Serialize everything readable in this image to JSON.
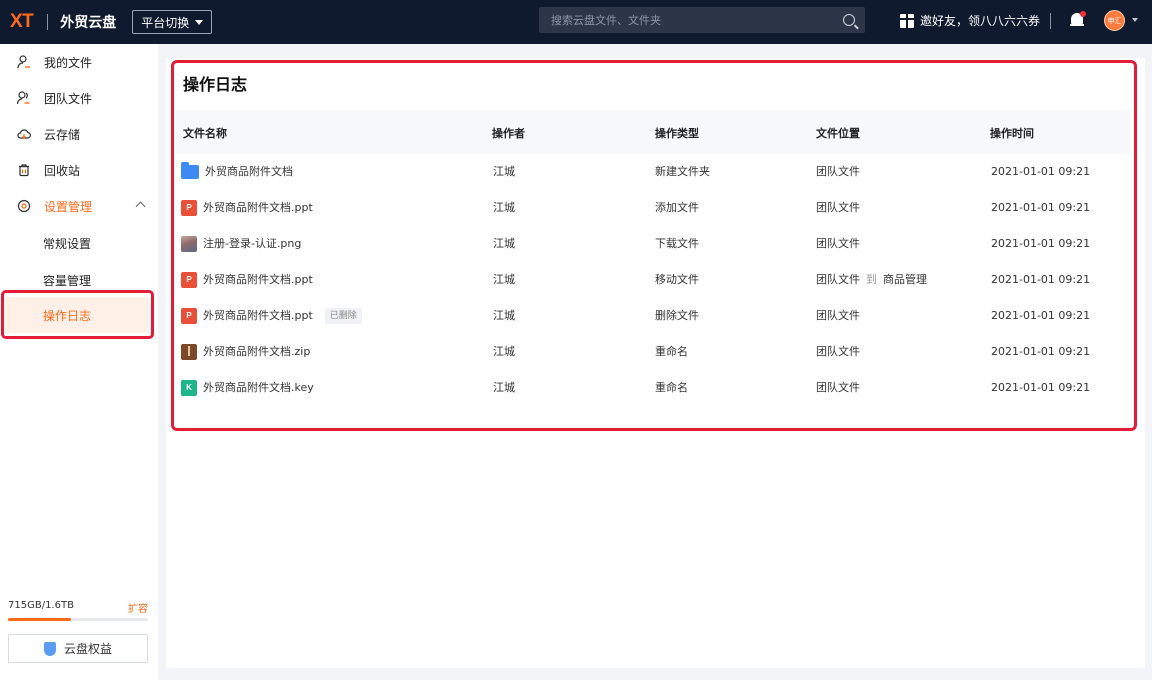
{
  "header": {
    "logo": "XT",
    "app_name": "外贸云盘",
    "platform_switch": "平台切换",
    "search_placeholder": "搜索云盘文件、文件夹",
    "invite": "邀好友，领八八六六券",
    "avatar_text": "申汇"
  },
  "sidebar": {
    "items": [
      {
        "label": "我的文件",
        "icon": "user-file-icon"
      },
      {
        "label": "团队文件",
        "icon": "team-file-icon"
      },
      {
        "label": "云存储",
        "icon": "cloud-icon"
      },
      {
        "label": "回收站",
        "icon": "trash-icon"
      },
      {
        "label": "设置管理",
        "icon": "settings-icon"
      }
    ],
    "sub_items": [
      {
        "label": "常规设置"
      },
      {
        "label": "容量管理"
      },
      {
        "label": "操作日志"
      }
    ],
    "storage_text": "715GB/1.6TB",
    "storage_fraction": 0.45,
    "expand_label": "扩容",
    "rights_label": "云盘权益"
  },
  "main": {
    "title": "操作日志",
    "columns": [
      "文件名称",
      "操作者",
      "操作类型",
      "文件位置",
      "操作时间"
    ],
    "rows": [
      {
        "name": "外贸商品附件文档",
        "type_icon": "folder",
        "operator": "江城",
        "action": "新建文件夹",
        "location": "团队文件",
        "time": "2021-01-01 09:21"
      },
      {
        "name": "外贸商品附件文档.ppt",
        "type_icon": "ppt",
        "operator": "江城",
        "action": "添加文件",
        "location": "团队文件",
        "time": "2021-01-01 09:21"
      },
      {
        "name": "注册-登录-认证.png",
        "type_icon": "image",
        "operator": "江城",
        "action": "下载文件",
        "location": "团队文件",
        "time": "2021-01-01 09:21"
      },
      {
        "name": "外贸商品附件文档.ppt",
        "type_icon": "ppt",
        "operator": "江城",
        "action": "移动文件",
        "location": "团队文件",
        "location_to": "商品管理",
        "to_word": "到",
        "time": "2021-01-01 09:21"
      },
      {
        "name": "外贸商品附件文档.ppt",
        "type_icon": "ppt",
        "badge": "已删除",
        "operator": "江城",
        "action": "删除文件",
        "location": "团队文件",
        "time": "2021-01-01 09:21"
      },
      {
        "name": "外贸商品附件文档.zip",
        "type_icon": "zip",
        "operator": "江城",
        "action": "重命名",
        "location": "团队文件",
        "time": "2021-01-01 09:21"
      },
      {
        "name": "外贸商品附件文档.key",
        "type_icon": "key",
        "operator": "江城",
        "action": "重命名",
        "location": "团队文件",
        "time": "2021-01-01 09:21"
      }
    ]
  }
}
